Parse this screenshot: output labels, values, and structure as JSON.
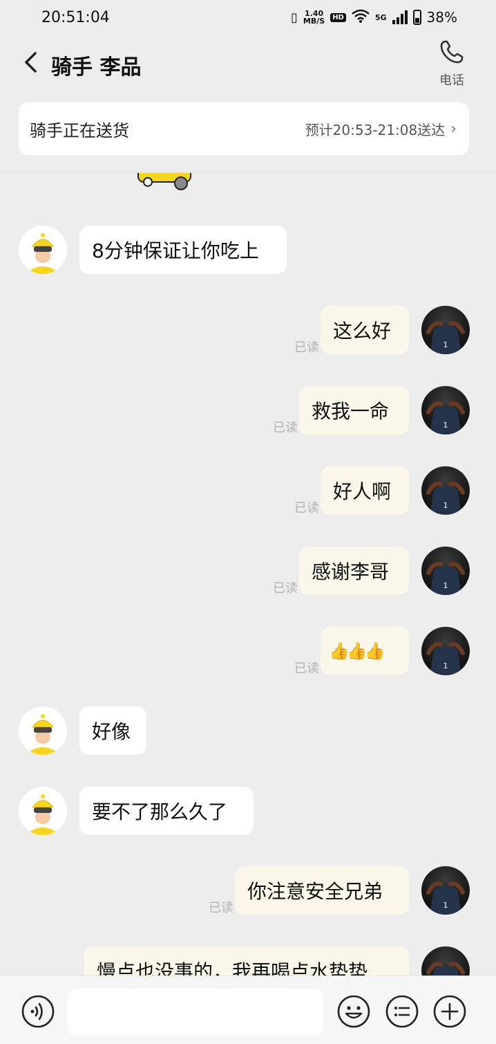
{
  "status_bar": {
    "time": "20:51:04",
    "net_speed_value": "1.40",
    "net_speed_unit": "MB/S",
    "hd_label": "HD",
    "network_label": "5G",
    "battery": "38%"
  },
  "header": {
    "title": "骑手 李品",
    "phone_label": "电话"
  },
  "delivery": {
    "status": "骑手正在送货",
    "eta": "预计20:53-21:08送达"
  },
  "read_label": "已读",
  "messages": [
    {
      "side": "left",
      "text": "8分钟保证让你吃上"
    },
    {
      "side": "right",
      "text": "这么好",
      "read": "已读"
    },
    {
      "side": "right",
      "text": "救我一命",
      "read": "已读"
    },
    {
      "side": "right",
      "text": "好人啊",
      "read": "已读"
    },
    {
      "side": "right",
      "text": "感谢李哥",
      "read": "已读"
    },
    {
      "side": "right",
      "text": "👍👍👍",
      "read": "已读"
    },
    {
      "side": "left",
      "text": "好像"
    },
    {
      "side": "left",
      "text": "要不了那么久了"
    },
    {
      "side": "right",
      "text": "你注意安全兄弟",
      "read": "已读"
    },
    {
      "side": "right",
      "text": "慢点也没事的，我再喝点水垫垫"
    }
  ],
  "icons": {
    "back": "chevron-left-icon",
    "phone": "phone-icon",
    "voice": "voice-icon",
    "emoji": "emoji-icon",
    "quick_reply": "list-icon",
    "plus": "plus-icon"
  },
  "colors": {
    "background": "#ededed",
    "bubble_self": "#fbf7ea",
    "bubble_other": "#ffffff",
    "read_text": "#b3b3b3",
    "rider_yellow": "#f7d51d"
  }
}
